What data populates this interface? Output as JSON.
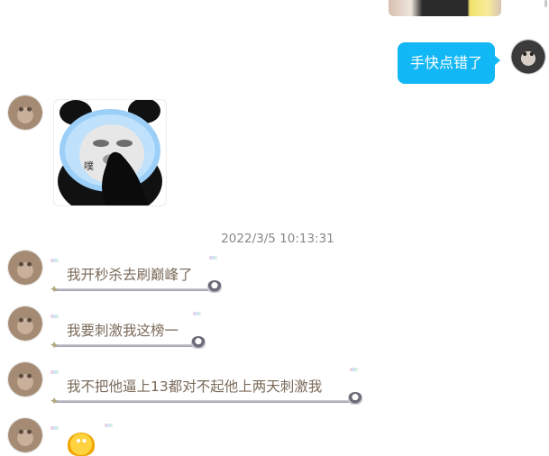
{
  "chat": {
    "outgoing_message": "手快点错了",
    "sticker_caption": "噗",
    "timestamp": "2022/3/5 10:13:31",
    "incoming_messages": [
      "我开秒杀去刷巅峰了",
      "我要刺激我这榜一",
      "我不把他逼上13都对不起他上两天刺激我"
    ]
  },
  "colors": {
    "outgoing_bubble": "#12b7f5",
    "incoming_text": "#7a6a5a",
    "timestamp": "#888888"
  }
}
